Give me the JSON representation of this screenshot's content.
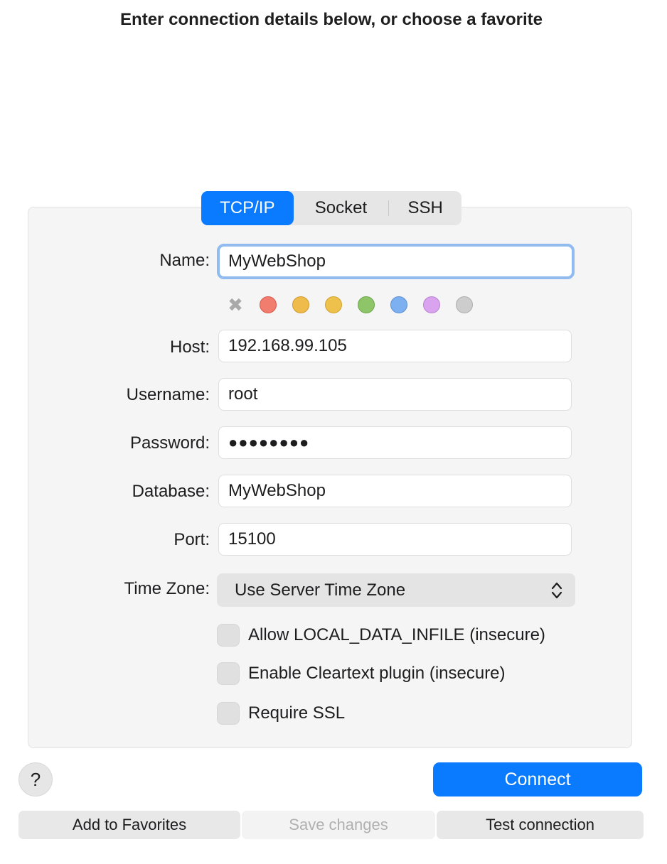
{
  "header": {
    "title": "Enter connection details below, or choose a favorite"
  },
  "tabs": [
    {
      "label": "TCP/IP",
      "active": true
    },
    {
      "label": "Socket",
      "active": false
    },
    {
      "label": "SSH",
      "active": false
    }
  ],
  "form": {
    "name_label": "Name:",
    "name_value": "MyWebShop",
    "host_label": "Host:",
    "host_value": "192.168.99.105",
    "username_label": "Username:",
    "username_value": "root",
    "password_label": "Password:",
    "password_value": "●●●●●●●●",
    "database_label": "Database:",
    "database_value": "MyWebShop",
    "port_label": "Port:",
    "port_value": "15100",
    "timezone_label": "Time Zone:",
    "timezone_value": "Use Server Time Zone"
  },
  "color_tags": {
    "clear_icon": "✖",
    "colors": [
      "#f17d6e",
      "#efbb4a",
      "#edc14c",
      "#8dc568",
      "#7cb0f1",
      "#d9a3ef",
      "#cdcdcd"
    ],
    "borders": [
      "#d8594a",
      "#d09b2c",
      "#d1a42e",
      "#6ca549",
      "#5b90d3",
      "#ba84d0",
      "#aeaeae"
    ]
  },
  "options": {
    "local_infile": "Allow LOCAL_DATA_INFILE (insecure)",
    "cleartext": "Enable Cleartext plugin (insecure)",
    "require_ssl": "Require SSL"
  },
  "actions": {
    "help": "?",
    "connect": "Connect",
    "add_favorites": "Add to Favorites",
    "save_changes": "Save changes",
    "test_connection": "Test connection"
  }
}
